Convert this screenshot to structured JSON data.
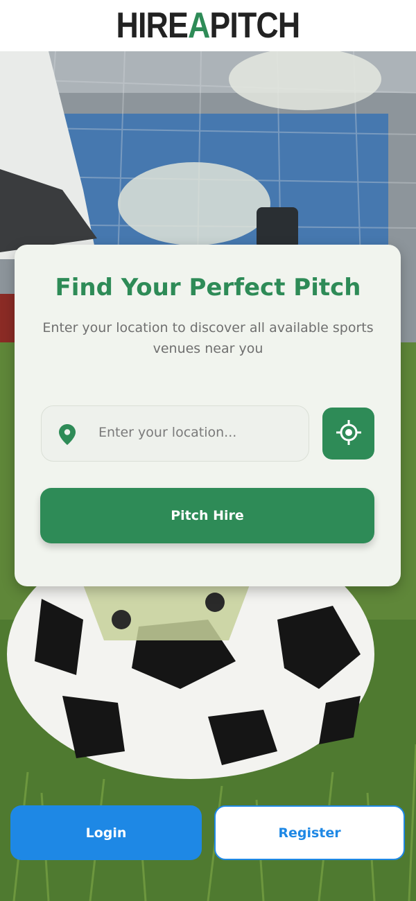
{
  "header": {
    "logo_part1": "HIRE",
    "logo_accent": "A",
    "logo_part2": "PITCH"
  },
  "search_card": {
    "title": "Find Your Perfect Pitch",
    "subtitle": "Enter your location to discover all available sports venues near you",
    "location_placeholder": "Enter your location...",
    "location_icon": "map-pin-icon",
    "gps_icon": "crosshair-gps-icon",
    "submit_label": "Pitch Hire"
  },
  "auth": {
    "login_label": "Login",
    "register_label": "Register"
  },
  "colors": {
    "brand_green": "#2e8b57",
    "login_blue": "#1e88e5",
    "card_bg": "#f1f4ee"
  }
}
